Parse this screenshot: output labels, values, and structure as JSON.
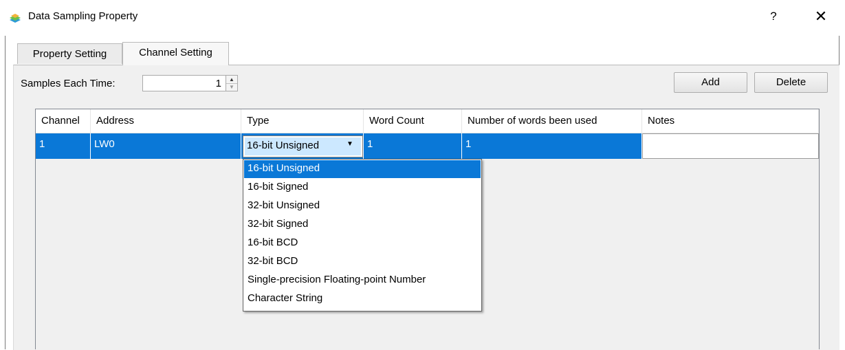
{
  "window": {
    "title": "Data Sampling Property",
    "help_label": "?",
    "close_label": "✕"
  },
  "tabs": [
    {
      "label": "Property Setting",
      "active": false
    },
    {
      "label": "Channel Setting",
      "active": true
    }
  ],
  "samples": {
    "label": "Samples Each Time:",
    "value": "1"
  },
  "buttons": {
    "add": "Add",
    "delete": "Delete"
  },
  "table": {
    "columns": [
      "Channel",
      "Address",
      "Type",
      "Word Count",
      "Number of words been used",
      "Notes"
    ],
    "rows": [
      {
        "channel": "1",
        "address": "LW0",
        "type": "16-bit Unsigned",
        "word_count": "1",
        "words_used": "1",
        "notes": ""
      }
    ]
  },
  "type_dropdown": {
    "selected": "16-bit Unsigned",
    "options": [
      "16-bit Unsigned",
      "16-bit Signed",
      "32-bit Unsigned",
      "32-bit Signed",
      "16-bit BCD",
      "32-bit BCD",
      "Single-precision Floating-point Number",
      "Character String"
    ]
  },
  "colors": {
    "selection": "#0a78d7",
    "combo_highlight": "#cce8ff",
    "panel_bg": "#f0f0f0"
  }
}
